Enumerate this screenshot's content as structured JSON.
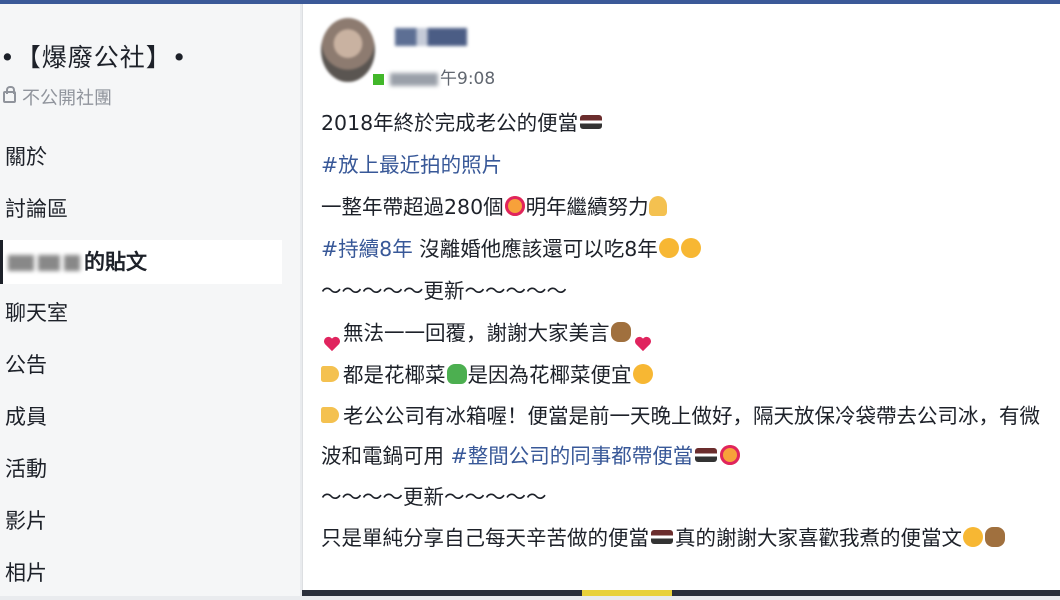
{
  "group": {
    "title": "•【爆廢公社】•",
    "privacy": "不公開社團"
  },
  "nav": {
    "items": [
      "關於",
      "討論區",
      "的貼文",
      "聊天室",
      "公告",
      "成員",
      "活動",
      "影片",
      "相片"
    ],
    "active_index": 2
  },
  "post": {
    "time": "午9:08",
    "lines": {
      "l1": "2018年終於完成老公的便當",
      "l2_tag": "#放上最近拍的照片",
      "l3a": "一整年帶超過280個",
      "l3b": "明年繼續努力",
      "l4_tag": "#持續8年",
      "l4b": " 沒離婚他應該還可以吃8年",
      "l5": "～～～～～更新～～～～～",
      "l6": "無法一一回覆，謝謝大家美言",
      "l7a": "都是花椰菜",
      "l7b": "是因為花椰菜便宜",
      "l8a": "老公公司有冰箱喔！便當是前一天晚上做好，隔天放保冷袋帶去公司冰，有微波和電鍋可用 ",
      "l8_tag": "#整間公司的同事都帶便當",
      "l9": "～～～～更新～～～～～",
      "l10a": "只是單純分享自己每天辛苦做的便當",
      "l10b": "真的謝謝大家喜歡我煮的便當文"
    }
  },
  "icons": {
    "lock": "lock-icon",
    "bento": "bento-emoji",
    "heart": "heart-emoji",
    "hand": "pointing-hand-emoji"
  },
  "colors": {
    "link": "#385898",
    "online": "#42b72a",
    "brand": "#3b5998"
  }
}
